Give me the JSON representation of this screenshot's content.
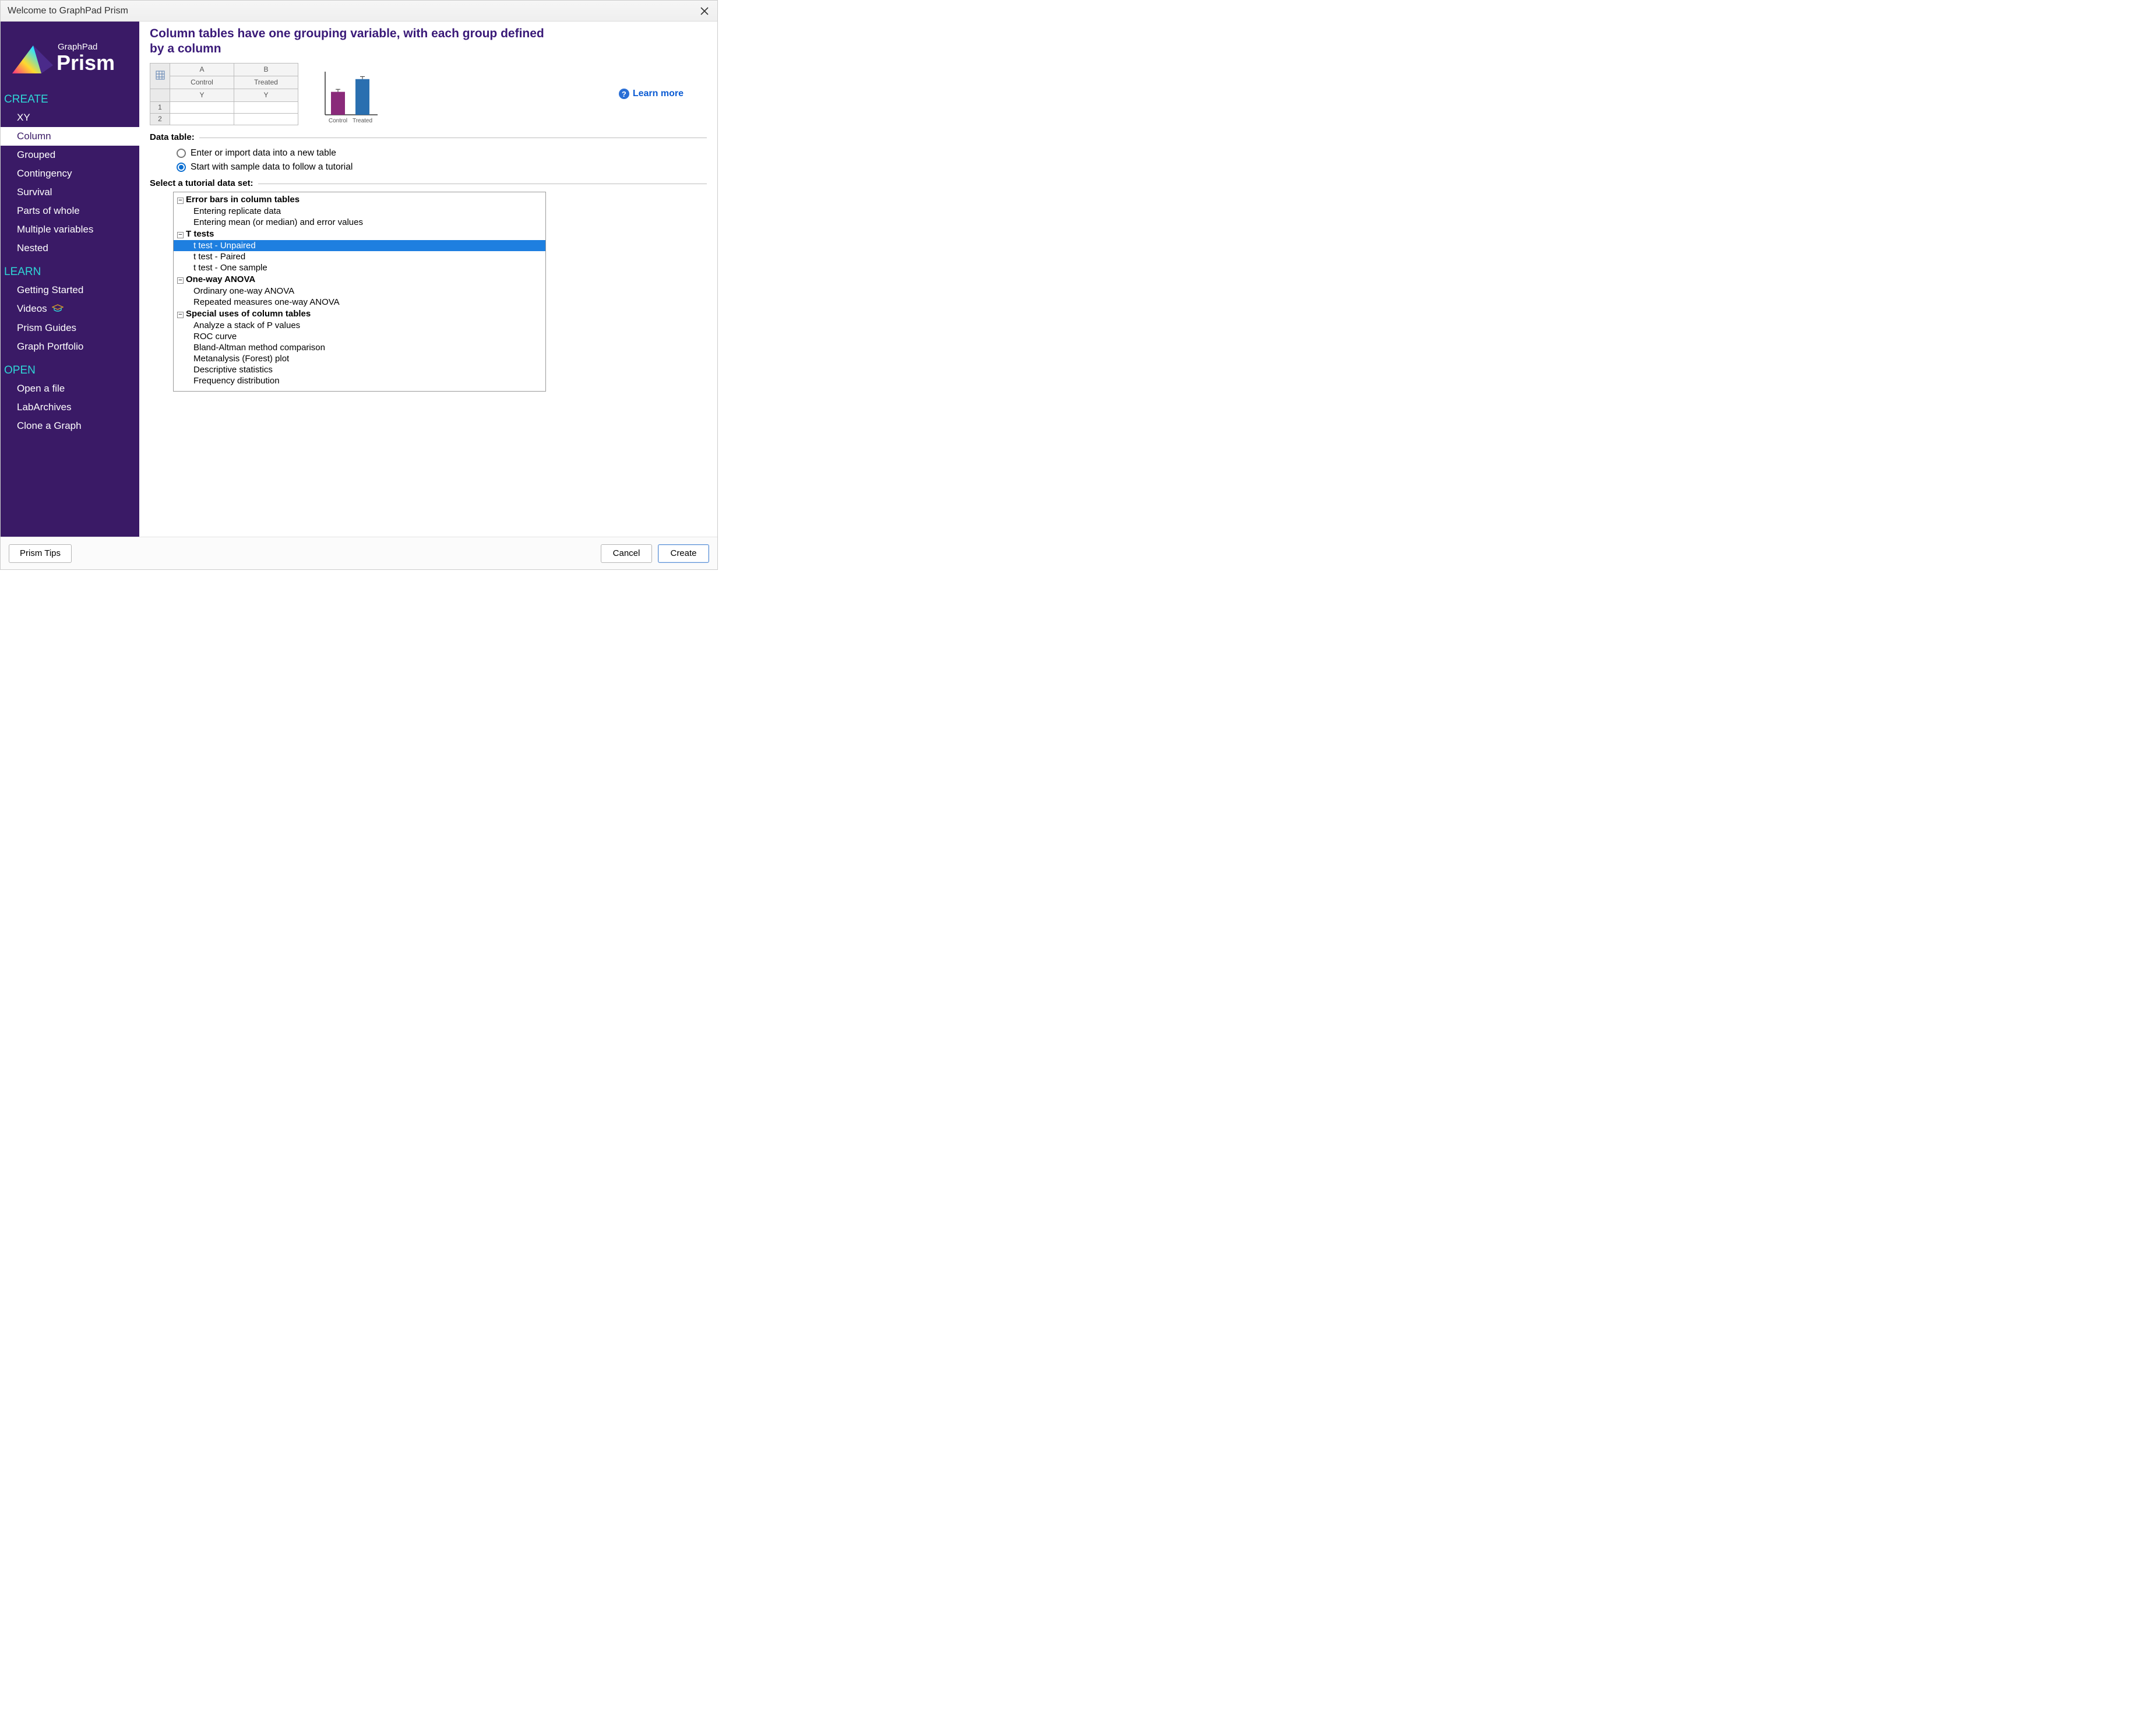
{
  "window": {
    "title": "Welcome to GraphPad Prism"
  },
  "logo": {
    "brand_small": "GraphPad",
    "brand_big": "Prism"
  },
  "sidebar": {
    "sections": [
      {
        "title": "CREATE",
        "items": [
          {
            "label": "XY",
            "selected": false
          },
          {
            "label": "Column",
            "selected": true
          },
          {
            "label": "Grouped",
            "selected": false
          },
          {
            "label": "Contingency",
            "selected": false
          },
          {
            "label": "Survival",
            "selected": false
          },
          {
            "label": "Parts of whole",
            "selected": false
          },
          {
            "label": "Multiple variables",
            "selected": false
          },
          {
            "label": "Nested",
            "selected": false
          }
        ]
      },
      {
        "title": "LEARN",
        "items": [
          {
            "label": "Getting Started",
            "selected": false
          },
          {
            "label": "Videos",
            "selected": false,
            "icon": "graduation"
          },
          {
            "label": "Prism Guides",
            "selected": false
          },
          {
            "label": "Graph Portfolio",
            "selected": false
          }
        ]
      },
      {
        "title": "OPEN",
        "items": [
          {
            "label": "Open a file",
            "selected": false
          },
          {
            "label": "LabArchives",
            "selected": false
          },
          {
            "label": "Clone a Graph",
            "selected": false
          }
        ]
      }
    ]
  },
  "main": {
    "heading": "Column tables have one grouping variable, with each group defined by a column",
    "sample_cols": {
      "A": "A",
      "B": "B",
      "A_label": "Control",
      "B_label": "Treated",
      "Y": "Y"
    },
    "learn_more": "Learn more",
    "data_table_label": "Data table:",
    "radios": {
      "new_table": "Enter or import data into a new table",
      "sample_data": "Start with sample data to follow a tutorial",
      "selected": "sample_data"
    },
    "select_label": "Select a tutorial data set:",
    "tree": [
      {
        "title": "Error bars in column tables",
        "items": [
          {
            "label": "Entering replicate data"
          },
          {
            "label": "Entering mean (or median) and error values"
          }
        ]
      },
      {
        "title": "T tests",
        "items": [
          {
            "label": "t test - Unpaired",
            "selected": true
          },
          {
            "label": "t test - Paired"
          },
          {
            "label": "t test - One sample"
          }
        ]
      },
      {
        "title": "One-way ANOVA",
        "items": [
          {
            "label": "Ordinary one-way ANOVA"
          },
          {
            "label": "Repeated measures one-way ANOVA"
          }
        ]
      },
      {
        "title": "Special uses of column tables",
        "items": [
          {
            "label": "Analyze a stack of P values"
          },
          {
            "label": "ROC curve"
          },
          {
            "label": "Bland-Altman method comparison"
          },
          {
            "label": "Metanalysis (Forest) plot"
          },
          {
            "label": "Descriptive statistics"
          },
          {
            "label": "Frequency distribution"
          }
        ]
      }
    ]
  },
  "chart_data": {
    "type": "bar",
    "categories": [
      "Control",
      "Treated"
    ],
    "values": [
      45,
      70
    ],
    "error": [
      5,
      5
    ],
    "colors": [
      "#8a2a7a",
      "#2a6fb0"
    ],
    "ylim": [
      0,
      80
    ]
  },
  "footer": {
    "tips": "Prism Tips",
    "cancel": "Cancel",
    "create": "Create"
  }
}
